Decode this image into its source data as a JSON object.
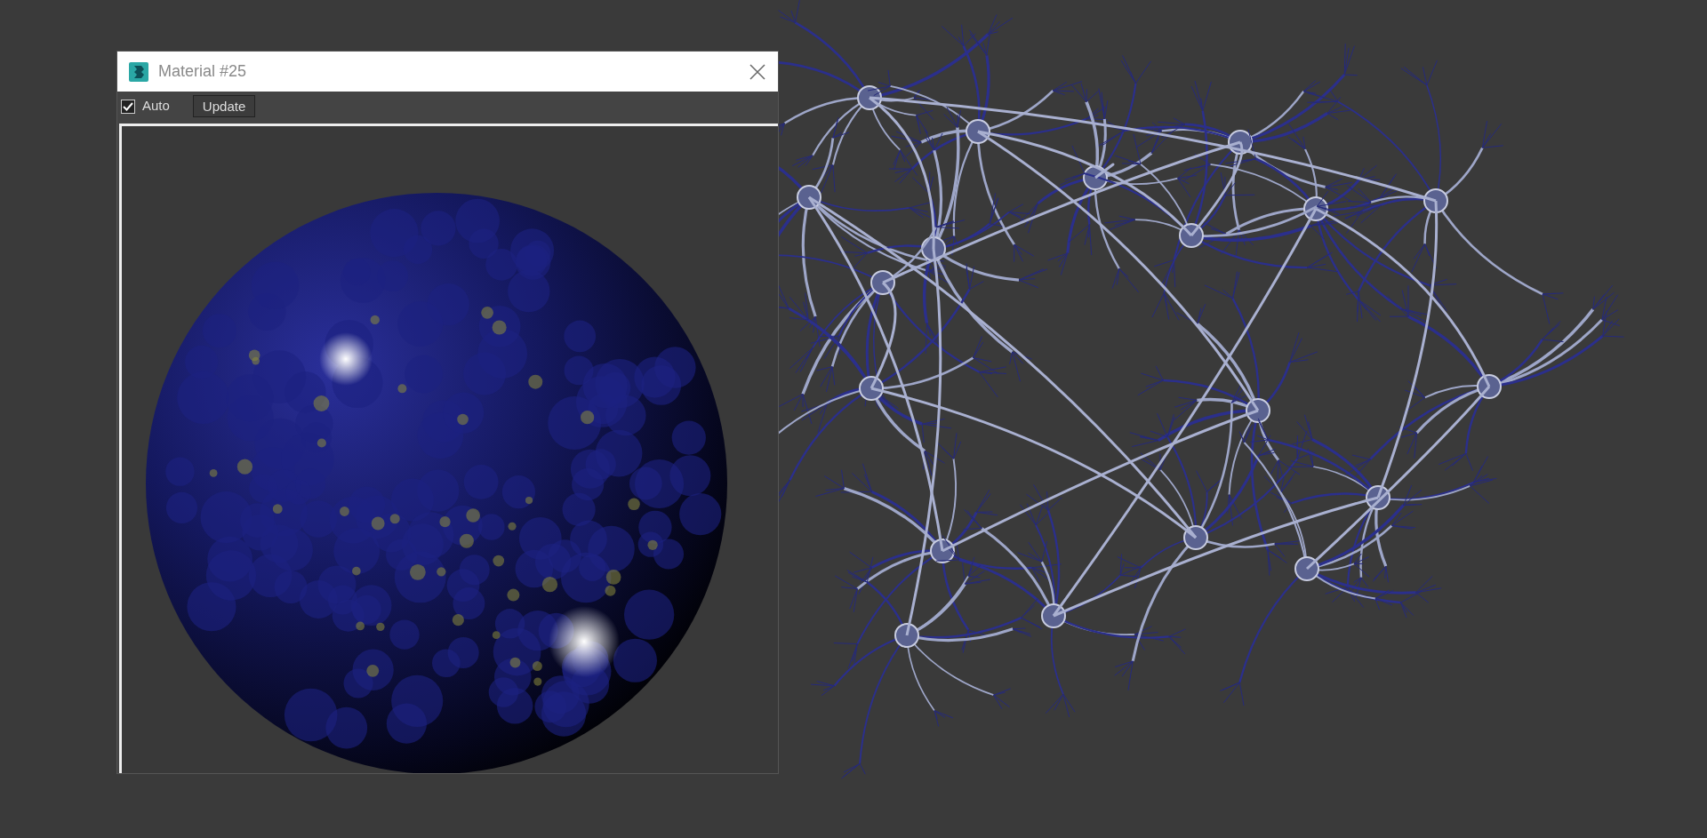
{
  "window": {
    "title": "Material #25"
  },
  "toolbar": {
    "auto": {
      "label": "Auto",
      "checked": true
    },
    "update_button": "Update"
  }
}
